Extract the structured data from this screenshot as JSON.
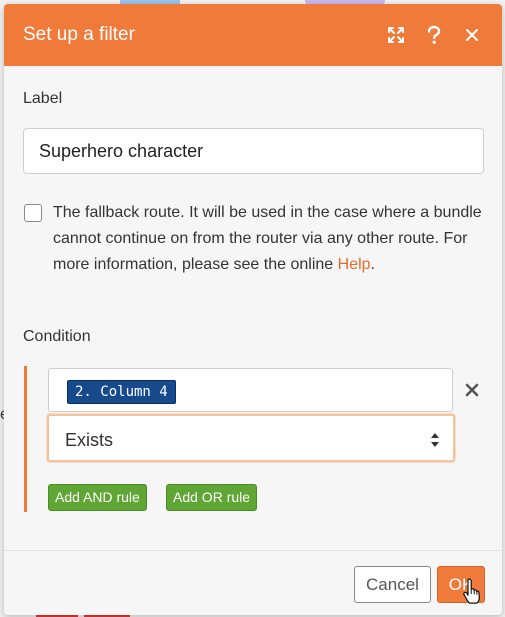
{
  "dialog": {
    "title": "Set up a filter",
    "header_icons": [
      "expand-icon",
      "help-icon",
      "close-icon"
    ],
    "accent_color": "#f07a3a"
  },
  "label_field": {
    "title": "Label",
    "value": "Superhero character"
  },
  "fallback": {
    "checked": false,
    "text_before": "The fallback route. It will be used in the case where a bundle cannot continue on from the router via any other route. For more information, please see the online ",
    "link": "Help",
    "text_after": "."
  },
  "condition": {
    "title": "Condition",
    "field_token": "2. Column 4",
    "operator": "Exists",
    "add_and_label": "Add AND rule",
    "add_or_label": "Add OR rule",
    "rule_button_color": "#5fa634",
    "token_color": "#164a8c"
  },
  "footer": {
    "cancel_label": "Cancel",
    "ok_label": "OK"
  },
  "background": {
    "peek_text": "e"
  }
}
